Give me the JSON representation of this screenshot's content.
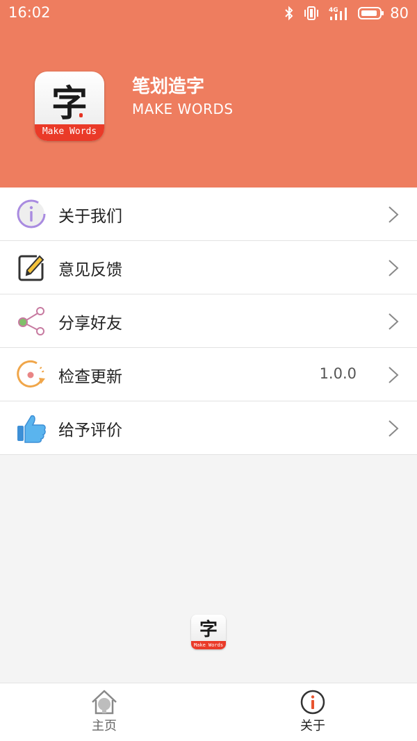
{
  "status_bar": {
    "time": "16:02",
    "signal_label": "4G",
    "battery": "80",
    "icons": [
      "bluetooth-icon",
      "vibrate-icon",
      "signal-icon",
      "battery-icon"
    ]
  },
  "app": {
    "name": "笔划造字",
    "subtitle": "MAKE WORDS",
    "logo_glyph": "字",
    "logo_band": "Make Words"
  },
  "menu": {
    "items": [
      {
        "label": "关于我们",
        "icon": "info-icon"
      },
      {
        "label": "意见反馈",
        "icon": "edit-icon"
      },
      {
        "label": "分享好友",
        "icon": "share-icon"
      },
      {
        "label": "检查更新",
        "icon": "update-icon",
        "value": "1.0.0"
      },
      {
        "label": "给予评价",
        "icon": "thumbs-up-icon"
      }
    ]
  },
  "tabs": [
    {
      "label": "主页",
      "icon": "home-icon",
      "active": false
    },
    {
      "label": "关于",
      "icon": "about-icon",
      "active": true
    }
  ],
  "colors": {
    "header": "#ee7d5f",
    "accent_red": "#ea3a28",
    "background": "#f4f4f4"
  }
}
